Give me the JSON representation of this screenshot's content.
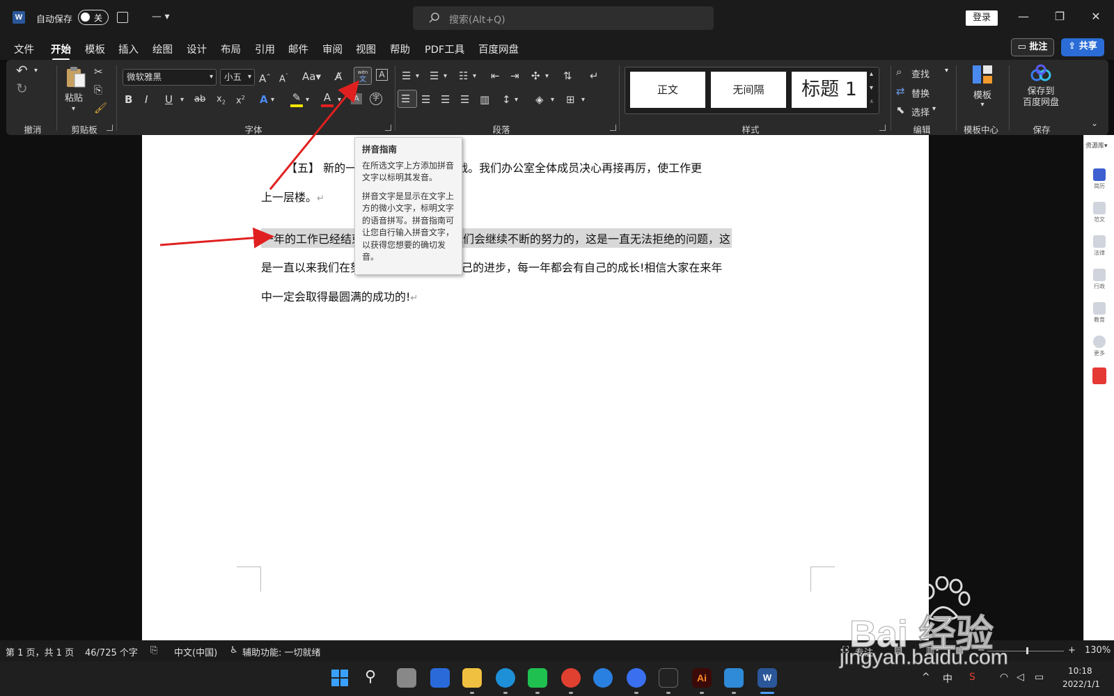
{
  "titlebar": {
    "autosave_label": "自动保存",
    "autosave_state": "关",
    "search_placeholder": "搜索(Alt+Q)",
    "login": "登录"
  },
  "tabs": [
    "文件",
    "开始",
    "模板",
    "插入",
    "绘图",
    "设计",
    "布局",
    "引用",
    "邮件",
    "审阅",
    "视图",
    "帮助",
    "PDF工具",
    "百度网盘"
  ],
  "active_tab": "开始",
  "buttons": {
    "comment": "批注",
    "share": "共享"
  },
  "ribbon": {
    "groups": {
      "undo": "撤消",
      "clipboard": "剪贴板",
      "font": "字体",
      "paragraph": "段落",
      "styles": "样式",
      "editing": "编辑",
      "template_center": "模板中心",
      "save": "保存"
    },
    "paste": "粘贴",
    "font_name": "微软雅黑",
    "font_size": "小五",
    "phonetic_icon_text": "wén",
    "styles": [
      "正文",
      "无间隔",
      "标题 1"
    ],
    "find": "查找",
    "replace": "替换",
    "select": "选择",
    "template": "模板",
    "save_to_baidu_line1": "保存到",
    "save_to_baidu_line2": "百度网盘"
  },
  "tooltip": {
    "title": "拼音指南",
    "p1": "在所选文字上方添加拼音文字以标明其发音。",
    "p2": "拼音文字是显示在文字上方的微小文字，标明文字的语音拼写。拼音指南可让您自行输入拼音文字，以获得您想要的确切发音。"
  },
  "document": {
    "line1": "【五】 新的一年，新的机遇新的挑战。我们办公室全体成员决心再接再厉，使工作更",
    "line2": "上一层楼。",
    "line3": "一年的工作已经结束，在新的一年中，我们会继续不断的努力的，这是一直无法拒绝的问题，这",
    "line4": "是一直以来我们在努力的，每一年都有自己的进步，每一年都会有自己的成长!相信大家在来年",
    "line5": "中一定会取得最圆满的成功的!",
    "para_mark": "↵"
  },
  "side_pane": {
    "title": "资源库",
    "items": [
      "简历",
      "范文",
      "法律",
      "行政",
      "教育",
      "更多"
    ]
  },
  "statusbar": {
    "page": "第 1 页，共 1 页",
    "words": "46/725 个字",
    "language": "中文(中国)",
    "accessibility": "辅助功能: 一切就绪",
    "focus": "专注",
    "zoom": "130%"
  },
  "taskbar": {
    "ime": "中",
    "time": "10:18",
    "date": "2022/1/1"
  },
  "watermark": {
    "text": "Bai 经验",
    "url": "jingyan.baidu.com"
  },
  "colors": {
    "accent_blue": "#2b6cd6",
    "arrow_red": "#e02020",
    "ribbon_bg": "#2a2a2a"
  }
}
